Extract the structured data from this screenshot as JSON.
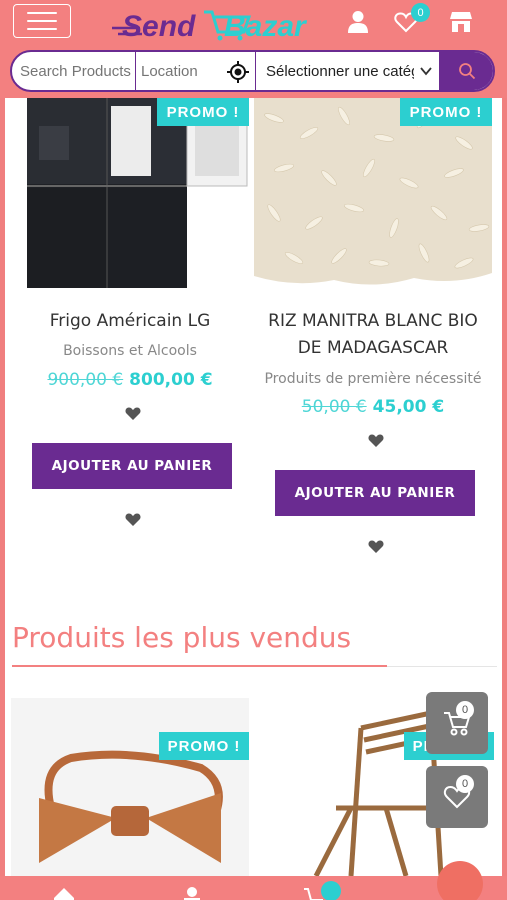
{
  "header": {
    "logo_text": "SendBazar",
    "wishlist_count": "0"
  },
  "search": {
    "product_placeholder": "Search Products",
    "location_placeholder": "Location",
    "category_select": "Sélectionner une catégorie"
  },
  "products": [
    {
      "badge": "PROMO !",
      "name": "Frigo Américain LG",
      "category": "Boissons et Alcools",
      "old_price": "900,00 €",
      "new_price": "800,00 €",
      "button": "AJOUTER AU PANIER"
    },
    {
      "badge": "PROMO !",
      "name": "RIZ MANITRA BLANC BIO DE MADAGASCAR",
      "category": "Produits de première nécessité",
      "old_price": "50,00 €",
      "new_price": "45,00 €",
      "button": "AJOUTER AU PANIER"
    }
  ],
  "best_sellers": {
    "title": "Produits les plus vendus",
    "items": [
      {
        "badge": "PROMO !"
      },
      {
        "badge": "PROMO !"
      }
    ]
  },
  "floating": {
    "cart_count": "0",
    "wishlist_count": "0"
  },
  "colors": {
    "brand_pink": "#f38080",
    "brand_purple": "#6a2b91",
    "accent_teal": "#2ccfd0"
  }
}
